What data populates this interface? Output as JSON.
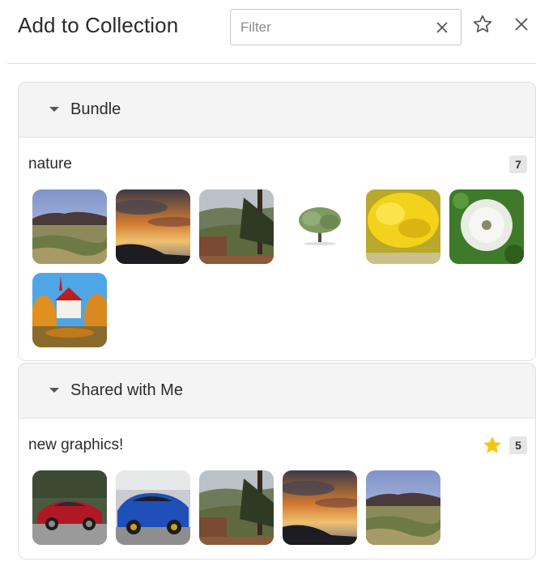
{
  "header": {
    "title": "Add to Collection",
    "filter_placeholder": "Filter",
    "filter_value": ""
  },
  "icons": {
    "filter_clear": "close-icon",
    "favorite": "star-outline-icon",
    "close": "close-icon",
    "section_toggle": "caret-down-icon",
    "favorite_badge": "star-filled-icon"
  },
  "colors": {
    "favorite_star": "#f5c518",
    "badge_bg": "#e6e6e6",
    "section_header_bg": "#f4f4f4"
  },
  "sections": [
    {
      "title": "Bundle",
      "collections": [
        {
          "name": "nature",
          "count": "7",
          "favorite": false,
          "thumbnails": [
            "hills-field",
            "sunset-clouds",
            "pine-valley",
            "lone-tree",
            "yellow-flower",
            "dandelion-seedhead",
            "red-church-autumn"
          ]
        }
      ]
    },
    {
      "title": "Shared with Me",
      "collections": [
        {
          "name": "new graphics!",
          "count": "5",
          "favorite": true,
          "thumbnails": [
            "red-sports-car",
            "blue-rally-car",
            "pine-valley",
            "sunset-clouds",
            "hills-field"
          ]
        }
      ]
    }
  ]
}
